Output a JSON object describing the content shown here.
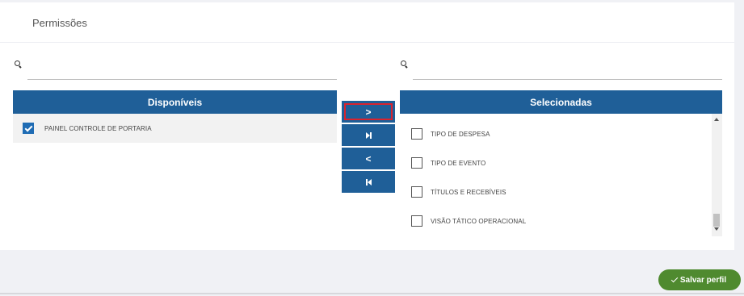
{
  "header": {
    "title": "Permissões"
  },
  "available": {
    "heading": "Disponíveis",
    "search_placeholder": "",
    "items": [
      {
        "label": "PAINEL CONTROLE DE PORTARIA",
        "checked": true
      }
    ]
  },
  "selected": {
    "heading": "Selecionadas",
    "search_placeholder": "",
    "items": [
      {
        "label": "TIPO DE DESPESA",
        "checked": false
      },
      {
        "label": "TIPO DE EVENTO",
        "checked": false
      },
      {
        "label": "TÍTULOS E RECEBÍVEIS",
        "checked": false
      },
      {
        "label": "VISÃO TÁTICO OPERACIONAL",
        "checked": false
      }
    ]
  },
  "transfer": {
    "move_right": ">",
    "move_left": "<"
  },
  "actions": {
    "save_label": "Salvar perfil"
  },
  "colors": {
    "panel_header": "#1f5f98",
    "save_button": "#4f8a2f",
    "highlight": "#d9232e"
  }
}
